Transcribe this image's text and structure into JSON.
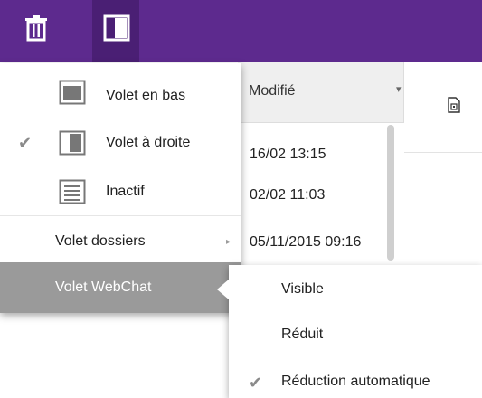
{
  "toolbar": {
    "trash_icon": "trash-icon",
    "pane_icon": "reading-pane-icon",
    "background_color": "#5d2a8e"
  },
  "list": {
    "column_header": "Modifié",
    "rows": [
      "16/02 13:15",
      "02/02 11:03",
      "05/11/2015 09:16"
    ]
  },
  "menu": {
    "items": [
      {
        "label": "Volet en bas",
        "icon": "pane-bottom-icon",
        "checked": false
      },
      {
        "label": "Volet à droite",
        "icon": "pane-right-icon",
        "checked": true
      },
      {
        "label": "Inactif",
        "icon": "pane-off-icon",
        "checked": false
      }
    ],
    "folders_label": "Volet dossiers",
    "webchat_label": "Volet WebChat",
    "check_glyph": "✔",
    "arrow_glyph": "▸",
    "selected_color": "#9a9a9a"
  },
  "submenu": {
    "items": [
      {
        "label": "Visible",
        "checked": false
      },
      {
        "label": "Réduit",
        "checked": false
      },
      {
        "label": "Réduction automatique",
        "checked": true
      }
    ]
  }
}
